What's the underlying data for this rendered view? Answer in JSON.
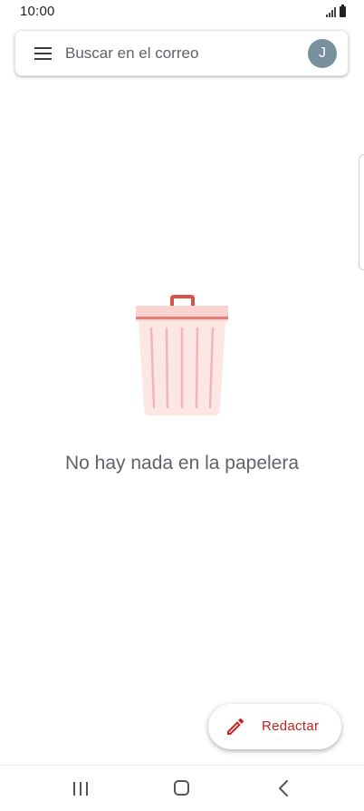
{
  "status_bar": {
    "time": "10:00",
    "icons": [
      "signal-icon",
      "battery-icon"
    ]
  },
  "search": {
    "placeholder": "Buscar en el correo",
    "menu_icon": "menu-icon",
    "avatar_initial": "J",
    "avatar_color": "#78909c"
  },
  "empty_state": {
    "illustration": "trash-can-icon",
    "message": "No hay nada en la papelera"
  },
  "compose": {
    "label": "Redactar",
    "icon": "pencil-icon",
    "accent_color": "#c5221f"
  },
  "nav_bar": {
    "items": [
      "recents-icon",
      "home-icon",
      "back-icon"
    ]
  }
}
